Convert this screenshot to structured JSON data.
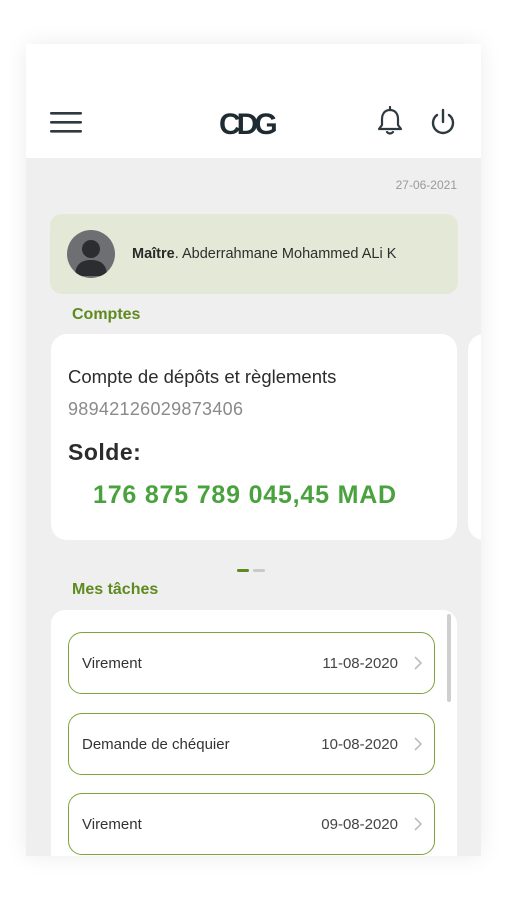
{
  "header": {
    "logo_text": "CDG",
    "date": "27-06-2021"
  },
  "profile": {
    "title": "Maître",
    "name": ". Abderrahmane Mohammed ALi K"
  },
  "accounts": {
    "section_title": "Comptes",
    "items": [
      {
        "name": "Compte de dépôts et règlements",
        "number": "98942126029873406",
        "balance_label": "Solde:",
        "balance": "176 875 789 045,45 MAD"
      }
    ],
    "page_count": 2,
    "active_page": 1
  },
  "tasks": {
    "section_title": "Mes tâches",
    "items": [
      {
        "label": "Virement",
        "date": "11-08-2020"
      },
      {
        "label": "Demande de chéquier",
        "date": "10-08-2020"
      },
      {
        "label": "Virement",
        "date": "09-08-2020"
      }
    ]
  },
  "icons": {
    "menu": "hamburger-menu-icon",
    "notifications": "bell-icon",
    "logout": "power-icon",
    "avatar": "user-avatar-icon",
    "chevron": "chevron-right-icon"
  },
  "colors": {
    "brand_green": "#5e8a1f",
    "balance_green": "#4aa23f",
    "task_border": "#7ea33d",
    "profile_bg": "#e3e9d6",
    "logo_dark": "#1f2b33"
  }
}
